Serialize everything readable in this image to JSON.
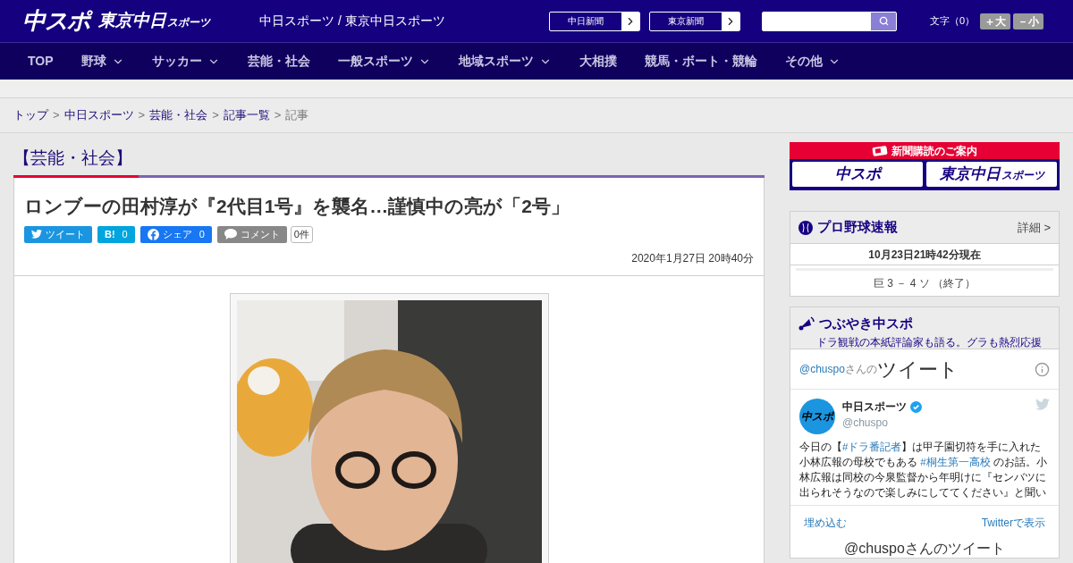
{
  "header": {
    "logo_main": "中スポ",
    "logo_sub": "東京中日",
    "logo_sub_small": "スポーツ",
    "site_title": "中日スポーツ / 東京中日スポーツ",
    "paper_links": [
      "中日新聞",
      "東京新聞"
    ],
    "text_size_label": "文字（0）",
    "text_size_buttons": [
      "＋大",
      "－小"
    ]
  },
  "nav": [
    {
      "label": "TOP",
      "has_menu": false
    },
    {
      "label": "野球",
      "has_menu": true
    },
    {
      "label": "サッカー",
      "has_menu": true
    },
    {
      "label": "芸能・社会",
      "has_menu": false
    },
    {
      "label": "一般スポーツ",
      "has_menu": true
    },
    {
      "label": "地域スポーツ",
      "has_menu": true
    },
    {
      "label": "大相撲",
      "has_menu": false
    },
    {
      "label": "競馬・ボート・競輪",
      "has_menu": false
    },
    {
      "label": "その他",
      "has_menu": true
    }
  ],
  "breadcrumb": [
    {
      "kind": "link",
      "text": "トップ"
    },
    {
      "kind": "separator",
      "text": ">"
    },
    {
      "kind": "link",
      "text": "中日スポーツ"
    },
    {
      "kind": "separator",
      "text": ">"
    },
    {
      "kind": "link",
      "text": "芸能・社会"
    },
    {
      "kind": "separator",
      "text": ">"
    },
    {
      "kind": "link",
      "text": "記事一覧"
    },
    {
      "kind": "separator",
      "text": ">"
    },
    {
      "kind": "current",
      "text": "記事"
    }
  ],
  "category": "【芸能・社会】",
  "article": {
    "title": "ロンブーの田村淳が『2代目1号』を襲名…謹慎中の亮が「2号」",
    "share": [
      {
        "kind": "twitter",
        "label": "ツイート"
      },
      {
        "kind": "hatena",
        "label": "B!",
        "count": "0"
      },
      {
        "kind": "facebook",
        "label": "シェア",
        "count": "0"
      },
      {
        "kind": "comment",
        "label": "コメント"
      }
    ],
    "comment_count": "0件",
    "date": "2020年1月27日 20時40分"
  },
  "sidebar": {
    "subscribe": {
      "title": "新聞購読のご案内",
      "logos": [
        {
          "main": "中スポ"
        },
        {
          "main": "東京中日",
          "small": "スポーツ"
        }
      ]
    },
    "baseball": {
      "title": "プロ野球速報",
      "detail": "詳細 >",
      "as_of": "10月23日21時42分現在",
      "score": "巨 3 － 4 ソ （終了）"
    },
    "tweets": {
      "title": "つぶやき中スポ",
      "subtitle": "ドラ観戦の本紙評論家も語る。グラも熱烈応援",
      "handle_link": "@chuspo",
      "handle_suffix": "さんの",
      "heading": "ツイート",
      "tweet": {
        "name": "中日スポーツ",
        "verified": true,
        "handle": "@chuspo",
        "avatar": "中スポ",
        "segments": [
          {
            "kind": "text",
            "text": "今日の【"
          },
          {
            "kind": "hashtag",
            "text": "#ドラ番記者"
          },
          {
            "kind": "text",
            "text": "】は甲子園切符を手に入れた小林広報の母校でもある "
          },
          {
            "kind": "hashtag",
            "text": "#桐生第一高校"
          },
          {
            "kind": "text",
            "text": " のお話。小林広報は同校の今泉監督から年明けに『センバツに出られそうなので楽しみにしててください』と聞い"
          }
        ]
      },
      "footer": [
        "埋め込む",
        "Twitterで表示"
      ],
      "next_heading": "@chuspoさんのツイート"
    }
  }
}
